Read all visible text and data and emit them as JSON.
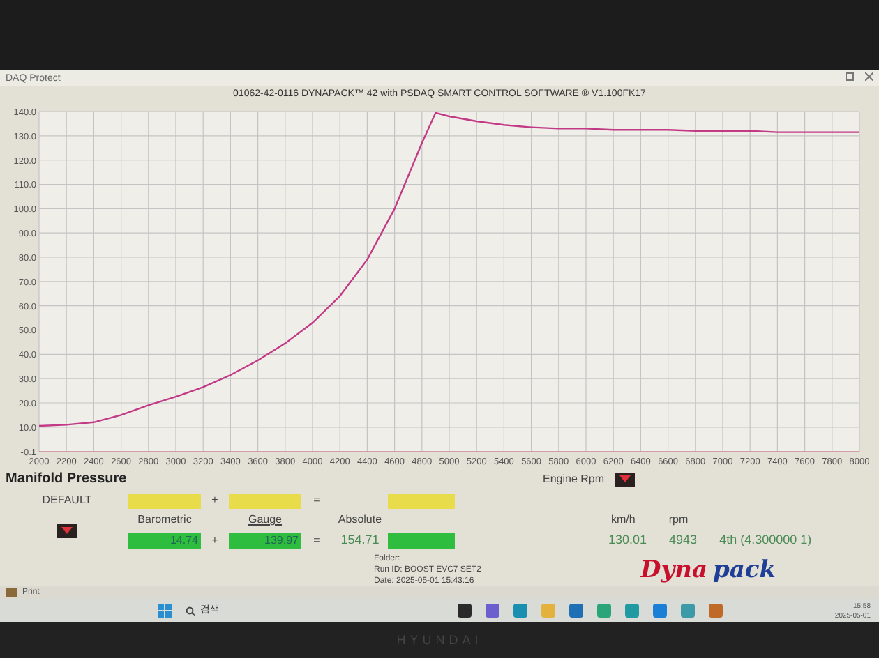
{
  "window": {
    "title": "DAQ Protect"
  },
  "chart": {
    "title": "01062-42-0116 DYNAPACK™ 42 with PSDAQ SMART CONTROL SOFTWARE ® V1.100FK17",
    "chart_data": {
      "type": "line",
      "x": [
        2000,
        2200,
        2400,
        2600,
        2800,
        3000,
        3200,
        3400,
        3600,
        3800,
        4000,
        4200,
        4400,
        4600,
        4800,
        4900,
        5000,
        5200,
        5400,
        5600,
        5800,
        6000,
        6200,
        6400,
        6600,
        6800,
        7000,
        7200,
        7400,
        7600,
        7800,
        8000
      ],
      "grid": true,
      "series": [
        {
          "color": "#c23a86",
          "values": [
            10.5,
            11,
            12,
            15,
            19,
            22.5,
            26.5,
            31.5,
            37.5,
            44.5,
            53,
            64,
            79,
            100,
            127,
            139.5,
            138,
            136,
            134.5,
            133.5,
            133,
            133,
            132.5,
            132.5,
            132.5,
            132,
            132,
            132,
            131.5,
            131.5,
            131.5,
            131.5
          ]
        }
      ],
      "xlim": [
        2000,
        8000
      ],
      "ylim": [
        -0.1,
        140
      ],
      "xticks": [
        2000,
        2200,
        2400,
        2600,
        2800,
        3000,
        3200,
        3400,
        3600,
        3800,
        4000,
        4200,
        4400,
        4600,
        4800,
        5000,
        5200,
        5400,
        5600,
        5800,
        6000,
        6200,
        6400,
        6600,
        6800,
        7000,
        7200,
        7400,
        7600,
        7800,
        8000
      ],
      "yticks": [
        {
          "value": -0.1,
          "label": "-0.1"
        },
        {
          "value": 10,
          "label": "10.0"
        },
        {
          "value": 20,
          "label": "20.0"
        },
        {
          "value": 30,
          "label": "30.0"
        },
        {
          "value": 40,
          "label": "40.0"
        },
        {
          "value": 50,
          "label": "50.0"
        },
        {
          "value": 60,
          "label": "60.0"
        },
        {
          "value": 70,
          "label": "70.0"
        },
        {
          "value": 80,
          "label": "80.0"
        },
        {
          "value": 90,
          "label": "90.0"
        },
        {
          "value": 100,
          "label": "100.0"
        },
        {
          "value": 110,
          "label": "110.0"
        },
        {
          "value": 120,
          "label": "120.0"
        },
        {
          "value": 130,
          "label": "130.0"
        },
        {
          "value": 140,
          "label": "140.0"
        }
      ]
    }
  },
  "panel": {
    "title": "Manifold Pressure",
    "x_selector": {
      "label": "Engine Rpm"
    },
    "preset": "DEFAULT",
    "barometric": {
      "label": "Barometric",
      "value": "14.74"
    },
    "plus_1": "+",
    "plus_2": "+",
    "gauge": {
      "label": "Gauge",
      "value": "139.97"
    },
    "equals_1": "=",
    "equals_2": "=",
    "absolute": {
      "label": "Absolute",
      "value": "154.71"
    },
    "speed": {
      "label": "km/h",
      "value": "130.01"
    },
    "rpm": {
      "label": "rpm",
      "value": "4943"
    },
    "gear": "4th (4.300000 1)",
    "folder_label": "Folder:",
    "run_id": "Run ID:  BOOST EVC7 SET2",
    "date": "Date:  2025-05-01 15:43:16"
  },
  "logo": {
    "parts": [
      {
        "text": "Dyna",
        "color": "#c8102e"
      },
      {
        "text": "pack",
        "color": "#1f3f96"
      }
    ]
  },
  "print_tab": {
    "label": "Print"
  },
  "taskbar": {
    "search": "검색",
    "clock_time": "15:58",
    "clock_date": "2025-05-01"
  },
  "bezel": {
    "brand": "HYUNDAI"
  }
}
